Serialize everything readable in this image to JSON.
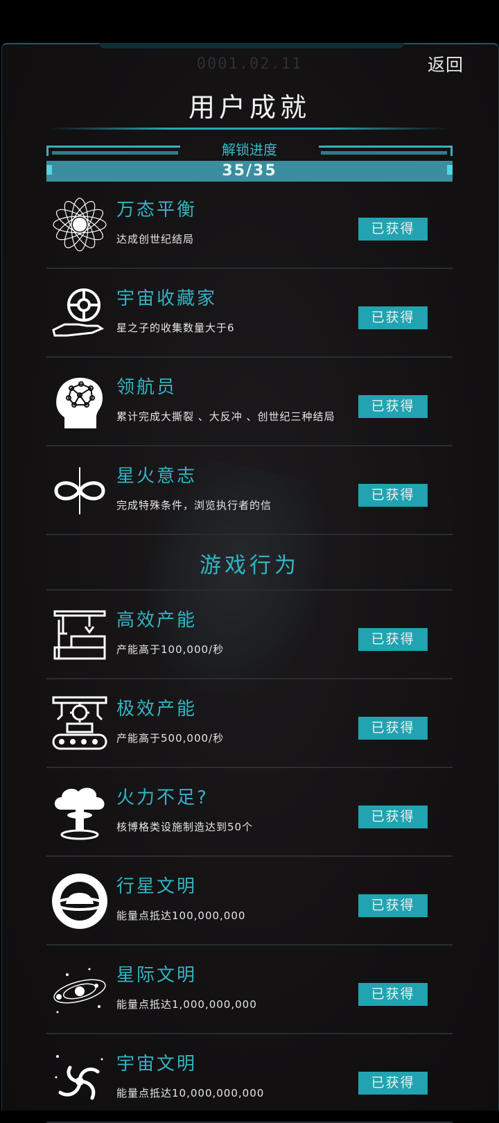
{
  "header": {
    "date": "0001.02.11",
    "back_label": "返回",
    "title": "用户成就"
  },
  "progress": {
    "label": "解锁进度",
    "count": "35/35",
    "fraction": 1.0
  },
  "colors": {
    "accent": "#33b4c4",
    "badge": "#21a3b1",
    "background": "#131112"
  },
  "achievements_top": [
    {
      "icon": "atom-orbit-icon",
      "name": "万态平衡",
      "desc": "达成创世纪结局",
      "status": "已获得"
    },
    {
      "icon": "hand-holding-globe-icon",
      "name": "宇宙收藏家",
      "desc": "星之子的收集数量大于6",
      "status": "已获得"
    },
    {
      "icon": "brain-head-icon",
      "name": "领航员",
      "desc": "累计完成大撕裂 、大反冲 、创世纪三种结局",
      "status": "已获得"
    },
    {
      "icon": "infinity-spark-icon",
      "name": "星火意志",
      "desc": "完成特殊条件，浏览执行者的信",
      "status": "已获得"
    }
  ],
  "section": {
    "title": "游戏行为"
  },
  "achievements_bottom": [
    {
      "icon": "robot-arm-factory-icon",
      "name": "高效产能",
      "desc": "产能高于100,000/秒",
      "status": "已获得"
    },
    {
      "icon": "gear-conveyor-icon",
      "name": "极效产能",
      "desc": "产能高于500,000/秒",
      "status": "已获得"
    },
    {
      "icon": "mushroom-cloud-icon",
      "name": "火力不足?",
      "desc": "核博格类设施制造达到50个",
      "status": "已获得"
    },
    {
      "icon": "planet-ring-icon",
      "name": "行星文明",
      "desc": "能量点抵达100,000,000",
      "status": "已获得"
    },
    {
      "icon": "solar-system-icon",
      "name": "星际文明",
      "desc": "能量点抵达1,000,000,000",
      "status": "已获得"
    },
    {
      "icon": "galaxy-spiral-icon",
      "name": "宇宙文明",
      "desc": "能量点抵达10,000,000,000",
      "status": "已获得"
    }
  ]
}
